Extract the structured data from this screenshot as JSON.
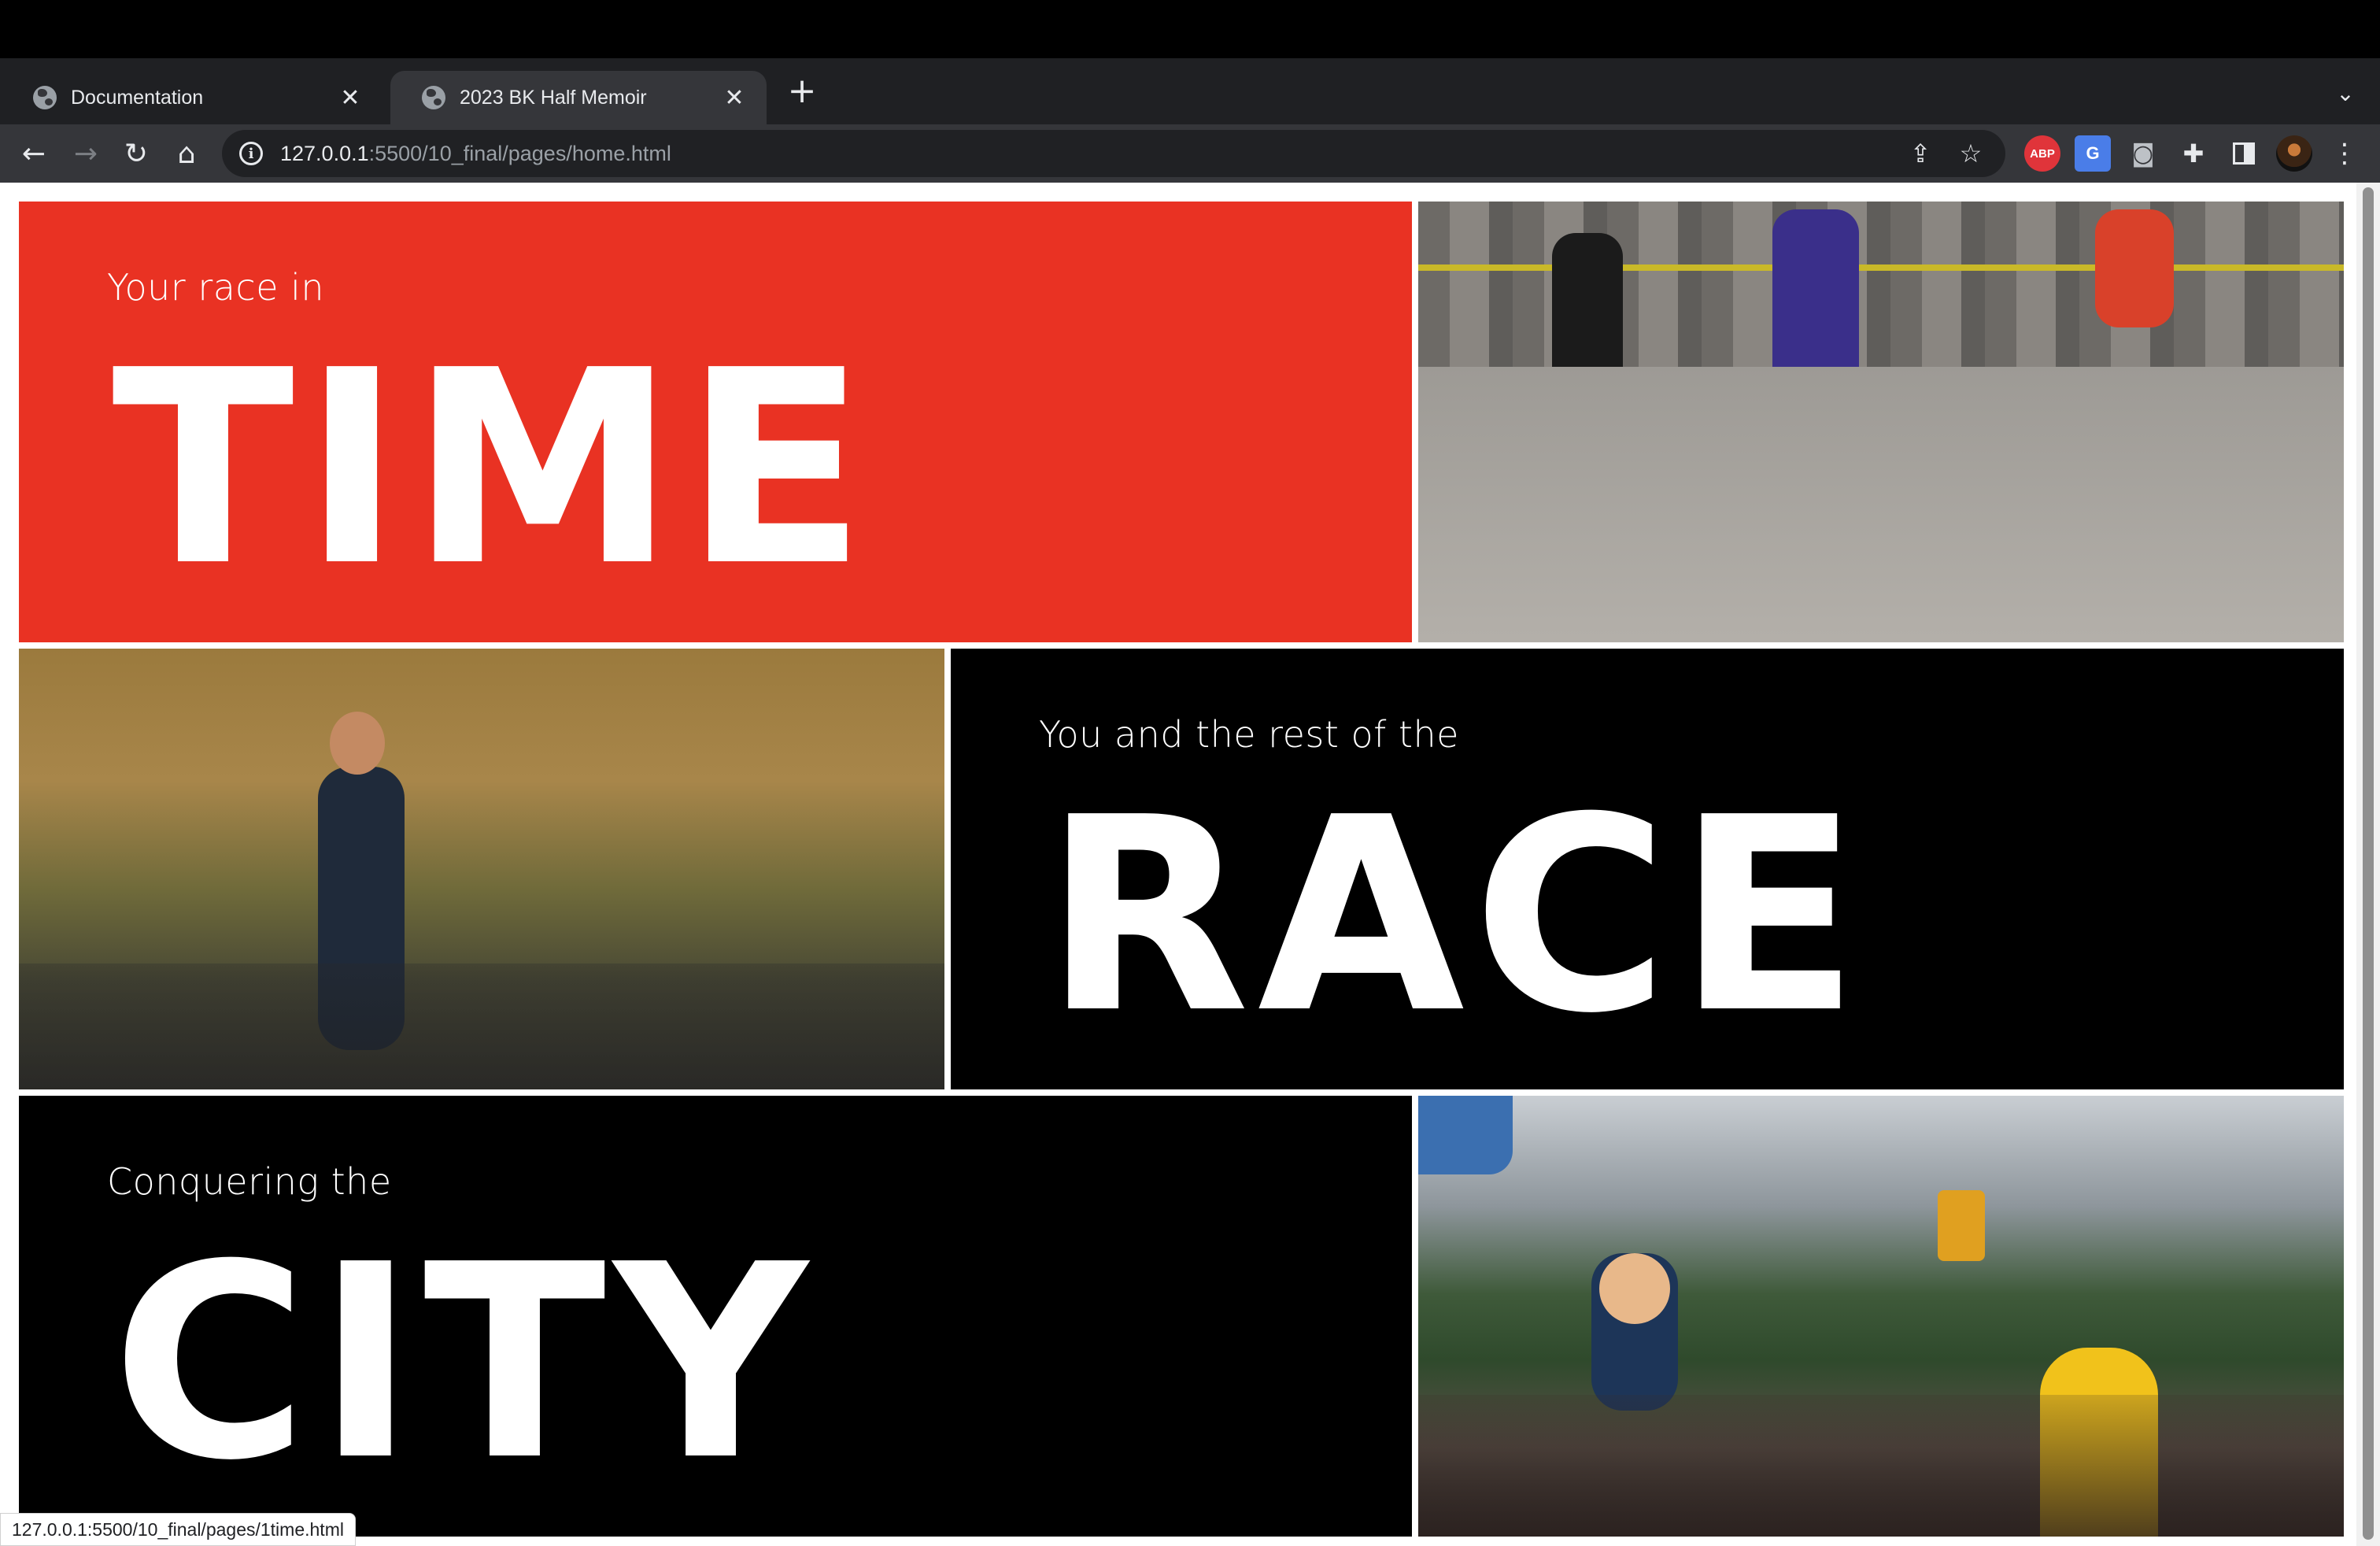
{
  "tabs": [
    {
      "title": "Documentation"
    },
    {
      "title": "2023 BK Half Memoir"
    }
  ],
  "address": {
    "host": "127.0.0.1",
    "path": ":5500/10_final/pages/home.html"
  },
  "extensions": {
    "abp_label": "ABP",
    "translate_label": "G"
  },
  "panels": {
    "time": {
      "lead": "Your race in",
      "big": "TIME"
    },
    "race": {
      "lead": "You and the rest of the",
      "big": "RACE"
    },
    "city": {
      "lead": "Conquering the",
      "big": "CITY"
    }
  },
  "status_url": "127.0.0.1:5500/10_final/pages/1time.html",
  "colors": {
    "accent_red": "#e93223",
    "panel_black": "#000000",
    "chrome_dark": "#35363a"
  }
}
